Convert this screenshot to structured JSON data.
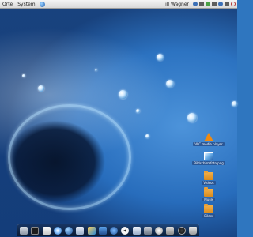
{
  "panel": {
    "menu": [
      "Orte",
      "System"
    ],
    "user": "Till Wagner"
  },
  "desktop_icons": [
    {
      "label": "VLC media player",
      "icon": "vlc-cone-icon"
    },
    {
      "label": "Bildschirmfoto.png",
      "icon": "image-file-icon"
    },
    {
      "label": "Videos",
      "icon": "folder-icon"
    },
    {
      "label": "Musik",
      "icon": "folder-icon"
    },
    {
      "label": "Bilder",
      "icon": "folder-icon"
    }
  ],
  "dock_items": [
    "finder-icon",
    "terminal-icon",
    "text-editor-icon",
    "water-drop-icon",
    "browser-globe-icon",
    "mail-icon",
    "photo-icon",
    "monitor-icon",
    "chat-icon",
    "back-arrow-icon",
    "grid-icon",
    "preferences-icon",
    "sync-icon",
    "box-icon",
    "power-icon",
    "trash-icon"
  ]
}
